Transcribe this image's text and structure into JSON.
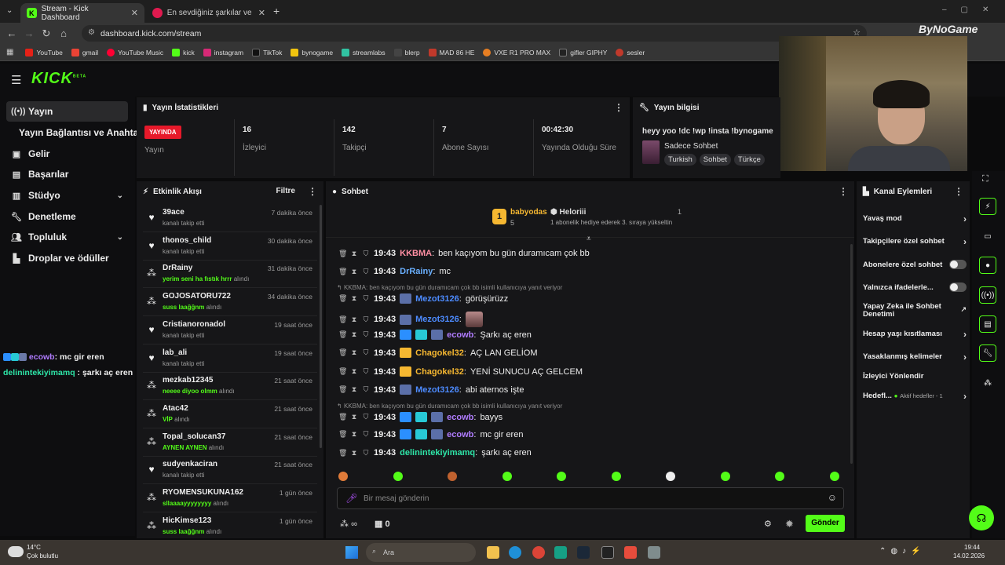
{
  "browser": {
    "tabs": [
      {
        "title": "Stream - Kick Dashboard",
        "active": true
      },
      {
        "title": "En sevdiğiniz şarkılar ve albümle",
        "active": false
      }
    ],
    "url": "dashboard.kick.com/stream",
    "bookmarks": [
      "YouTube",
      "gmail",
      "YouTube Music",
      "kick",
      "instagram",
      "TikTok",
      "bynogame",
      "streamlabs",
      "blerp",
      "MAD 86 HE",
      "VXE R1 PRO MAX",
      "gifler GIPHY",
      "sesler"
    ],
    "overlay_logo": "ByNoGame"
  },
  "header": {
    "logo": "KICK",
    "logo_tag": "BETA"
  },
  "sidebar": {
    "items": [
      {
        "label": "Yayın",
        "icon": "broadcast-icon"
      },
      {
        "label": "Yayın Bağlantısı ve Anahtarı",
        "icon": ""
      },
      {
        "label": "Gelir",
        "icon": "money-icon"
      },
      {
        "label": "Başarılar",
        "icon": "award-icon"
      },
      {
        "label": "Stüdyo",
        "icon": "studio-icon"
      },
      {
        "label": "Denetleme",
        "icon": "wrench-icon"
      },
      {
        "label": "Topluluk",
        "icon": "people-icon"
      },
      {
        "label": "Droplar ve ödüller",
        "icon": "gift-icon"
      }
    ]
  },
  "overlay_chat": [
    {
      "user": "ecowb",
      "text": "mc gir eren"
    },
    {
      "user": "delinintekiyimamq",
      "text": "şarkı aç eren"
    }
  ],
  "stats": {
    "title": "Yayın İstatistikleri",
    "live_badge": "YAYINDA",
    "live_label": "Yayın",
    "items": [
      {
        "value": "16",
        "label": "İzleyici"
      },
      {
        "value": "142",
        "label": "Takipçi"
      },
      {
        "value": "7",
        "label": "Abone Sayısı"
      },
      {
        "value": "00:42:30",
        "label": "Yayında Olduğu Süre"
      }
    ]
  },
  "stream_info": {
    "title": "Yayın bilgisi",
    "stream_title": "heyy yoo !dc !wp !insta !bynogame",
    "category": "Sadece Sohbet",
    "tags": [
      "Turkish",
      "Sohbet",
      "Türkçe"
    ]
  },
  "activity": {
    "title": "Etkinlik Akışı",
    "filter_label": "Filtre",
    "items": [
      {
        "name": "39ace",
        "desc": "kanalı takip etti",
        "time": "7 dakika önce",
        "kind": "follow"
      },
      {
        "name": "thonos_child",
        "desc": "kanalı takip etti",
        "time": "30 dakika önce",
        "kind": "follow"
      },
      {
        "name": "DrRainy",
        "reward": "yerim seni ha fıstık hrrr",
        "suffix": "alındı",
        "time": "31 dakika önce",
        "kind": "reward"
      },
      {
        "name": "GOJOSATORU722",
        "reward": "suss laağğnm",
        "suffix": "alındı",
        "time": "34 dakika önce",
        "kind": "reward"
      },
      {
        "name": "Cristianoronadol",
        "desc": "kanalı takip etti",
        "time": "19 saat önce",
        "kind": "follow"
      },
      {
        "name": "lab_ali",
        "desc": "kanalı takip etti",
        "time": "19 saat önce",
        "kind": "follow"
      },
      {
        "name": "mezkab12345",
        "reward": "neeee diyoo olmm",
        "suffix": "alındı",
        "time": "21 saat önce",
        "kind": "reward"
      },
      {
        "name": "Atac42",
        "reward": "VİP",
        "suffix": "alındı",
        "time": "21 saat önce",
        "kind": "reward"
      },
      {
        "name": "Topal_solucan37",
        "reward": "AYNEN AYNEN",
        "suffix": "alındı",
        "time": "21 saat önce",
        "kind": "reward"
      },
      {
        "name": "sudyenkaciran",
        "desc": "kanalı takip etti",
        "time": "21 saat önce",
        "kind": "follow"
      },
      {
        "name": "RYOMENSUKUNA162",
        "reward": "sllaaaayyyyyyyy",
        "suffix": "alındı",
        "time": "1 gün önce",
        "kind": "reward"
      },
      {
        "name": "HicKimse123",
        "reward": "suss laağğnm",
        "suffix": "alındı",
        "time": "1 gün önce",
        "kind": "reward"
      }
    ]
  },
  "chat": {
    "title": "Sohbet",
    "pinned": {
      "user1": "babyodas",
      "user1_count": "5",
      "rank": "1",
      "user2": "Heloriii",
      "user2_count": "1",
      "gift_text": "1 abonelik hediye ederek 3. sıraya yükseltin"
    },
    "messages": [
      {
        "time": "19:43",
        "user": "KKBMA",
        "color": "#ff8fa3",
        "text": "ben kaçıyom bu gün duramıcam çok bb",
        "badges": 0
      },
      {
        "time": "19:43",
        "user": "DrRainy",
        "color": "#6ab0ff",
        "text": "mc",
        "badges": 0
      },
      {
        "reply": "KKBMA: ben kaçıyom bu gün duramıcam çok bb isimli kullanıcıya yanıt veriyor"
      },
      {
        "time": "19:43",
        "user": "Mezot3126",
        "color": "#4d8bff",
        "text": "görüşürüzz",
        "badges": 1
      },
      {
        "time": "19:43",
        "user": "Mezot3126",
        "color": "#4d8bff",
        "text": "",
        "badges": 1,
        "emote": true
      },
      {
        "time": "19:43",
        "user": "ecowb",
        "color": "#b07cff",
        "text": "Şarkı aç eren",
        "badges": 3
      },
      {
        "time": "19:43",
        "user": "Chagokel32",
        "color": "#f5b731",
        "text": "AÇ LAN GELİOM",
        "badges": 1
      },
      {
        "time": "19:43",
        "user": "Chagokel32",
        "color": "#f5b731",
        "text": "YENİ SUNUCU AÇ GELCEM",
        "badges": 1
      },
      {
        "time": "19:43",
        "user": "Mezot3126",
        "color": "#4d8bff",
        "text": "abi aternos işte",
        "badges": 1
      },
      {
        "reply": "KKBMA: ben kaçıyom bu gün duramıcam çok bb isimli kullanıcıya yanıt veriyor"
      },
      {
        "time": "19:43",
        "user": "ecowb",
        "color": "#b07cff",
        "text": "bayys",
        "badges": 3
      },
      {
        "time": "19:43",
        "user": "ecowb",
        "color": "#b07cff",
        "text": "mc gir eren",
        "badges": 3
      },
      {
        "time": "19:43",
        "user": "delinintekiyimamq",
        "color": "#2ee6a8",
        "text": "şarkı aç eren",
        "badges": 0
      }
    ],
    "input_placeholder": "Bir mesaj gönderin",
    "points_label": "∞",
    "gift_count": "0",
    "send_label": "Gönder"
  },
  "channel_actions": {
    "title": "Kanal Eylemleri",
    "items": [
      {
        "label": "Yavaş mod",
        "control": "chevron"
      },
      {
        "label": "Takipçilere özel sohbet",
        "control": "chevron"
      },
      {
        "label": "Abonelere özel sohbet",
        "control": "toggle"
      },
      {
        "label": "Yalnızca ifadelerle...",
        "control": "toggle"
      },
      {
        "label": "Yapay Zeka ile Sohbet Denetimi",
        "control": "external"
      },
      {
        "label": "Hesap yaşı kısıtlaması",
        "control": "chevron"
      },
      {
        "label": "Yasaklanmış kelimeler",
        "control": "chevron"
      },
      {
        "label": "İzleyici Yönlendir",
        "control": "none"
      },
      {
        "label": "Hedefl...",
        "sub": "Aktif hedefler - 1",
        "control": "chevron"
      }
    ]
  },
  "taskbar": {
    "weather_temp": "14°C",
    "weather_desc": "Çok bulutlu",
    "search_placeholder": "Ara",
    "time": "19:44",
    "date": "14.02.2026"
  },
  "colors": {
    "accent": "#53fc18",
    "panel": "#161618",
    "bg": "#0b0b0c"
  }
}
